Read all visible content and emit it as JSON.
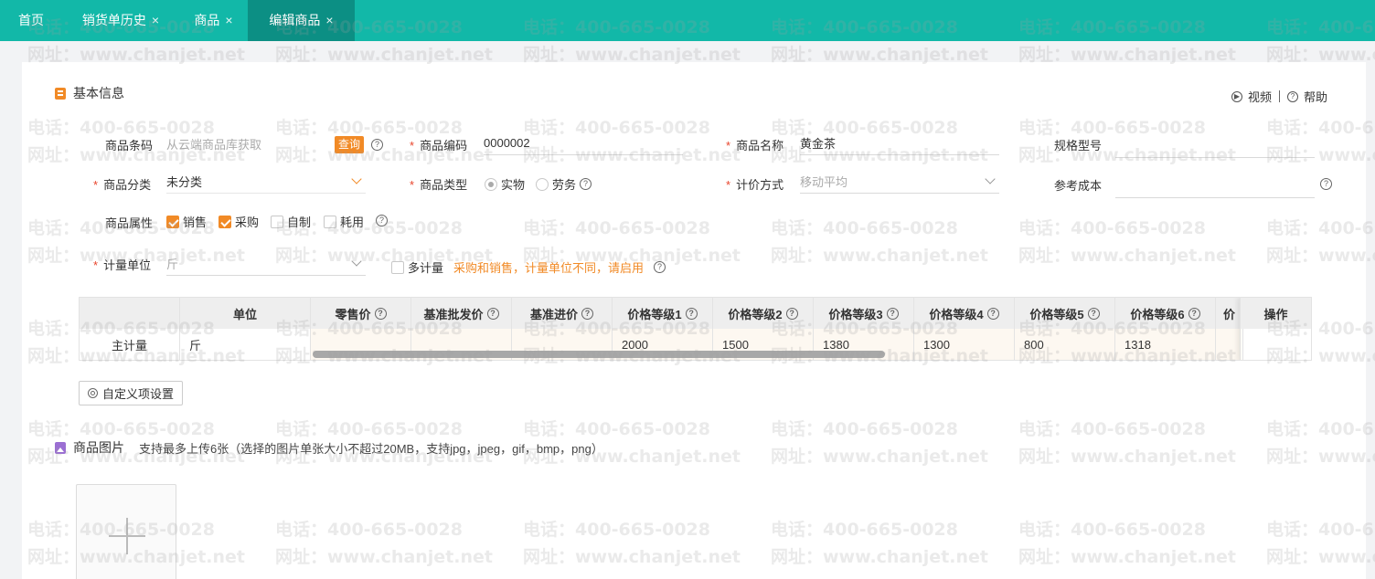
{
  "tabs": [
    {
      "label": "首页",
      "closable": false,
      "active": false
    },
    {
      "label": "销货单历史",
      "closable": true,
      "active": false
    },
    {
      "label": "商品",
      "closable": true,
      "active": false
    },
    {
      "label": "编辑商品",
      "closable": true,
      "active": true
    }
  ],
  "close_glyph": "×",
  "basic": {
    "title": "基本信息",
    "video_label": "视频",
    "help_label": "帮助"
  },
  "form": {
    "barcode": {
      "label": "商品条码",
      "placeholder": "从云端商品库获取",
      "query_label": "查询"
    },
    "code": {
      "label": "商品编码",
      "value": "0000002"
    },
    "name": {
      "label": "商品名称",
      "value": "黄金茶"
    },
    "spec": {
      "label": "规格型号",
      "value": ""
    },
    "category": {
      "label": "商品分类",
      "value": "未分类"
    },
    "type": {
      "label": "商品类型",
      "options": [
        "实物",
        "劳务"
      ],
      "selected": "实物"
    },
    "pricing": {
      "label": "计价方式",
      "value": "移动平均"
    },
    "ref_cost": {
      "label": "参考成本",
      "value": ""
    },
    "attrs": {
      "label": "商品属性",
      "options": [
        {
          "label": "销售",
          "checked": true
        },
        {
          "label": "采购",
          "checked": true
        },
        {
          "label": "自制",
          "checked": false
        },
        {
          "label": "耗用",
          "checked": false
        }
      ]
    },
    "unit": {
      "label": "计量单位",
      "value": "斤"
    },
    "multi_unit": {
      "label": "多计量",
      "checked": false,
      "hint": "采购和销售，计量单位不同，请启用"
    }
  },
  "price_table": {
    "columns": [
      "",
      "单位",
      "零售价",
      "基准批发价",
      "基准进价",
      "价格等级1",
      "价格等级2",
      "价格等级3",
      "价格等级4",
      "价格等级5",
      "价格等级6",
      "价"
    ],
    "ops_header": "操作",
    "rows": [
      [
        "主计量",
        "斤",
        "",
        "",
        "",
        "2000",
        "1500",
        "1380",
        "1300",
        "800",
        "1318",
        ""
      ]
    ]
  },
  "custom_button": "自定义项设置",
  "images": {
    "title": "商品图片",
    "hint": "支持最多上传6张（选择的图片单张大小不超过20MB，支持jpg，jpeg，gif，bmp，png）"
  },
  "watermark": {
    "phone": "电话：400-665-0028",
    "site": "网址：www.chanjet.net"
  },
  "colors": {
    "tab_bar": "#12b8a8",
    "tab_active": "#0c8f84",
    "accent": "#f18a26",
    "required": "#e8452c"
  }
}
